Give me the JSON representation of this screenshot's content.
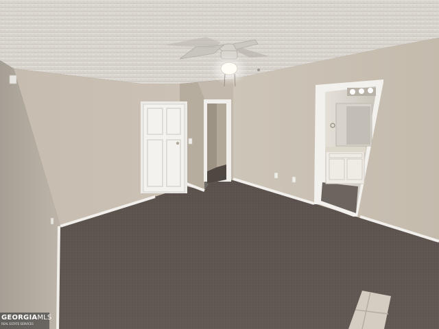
{
  "photo": {
    "subject": "Empty carpeted bedroom with ceiling fan, white closet door, hallway opening, and doorway to a bathroom vanity",
    "colors": {
      "ceiling": "#d8d4ce",
      "wall_light": "#cfc6b8",
      "wall_shadow": "#a79e92",
      "carpet": "#5f5650",
      "trim": "#f2f0ec",
      "door": "#f4f2ee"
    },
    "icons": [
      "ceiling-fan-icon",
      "light-fixture-icon",
      "door-icon",
      "vanity-icon",
      "mirror-icon"
    ]
  },
  "watermark": {
    "brand_main": "GEORGIA",
    "brand_suffix": "MLS",
    "tagline": "REAL ESTATE SERVICES"
  }
}
